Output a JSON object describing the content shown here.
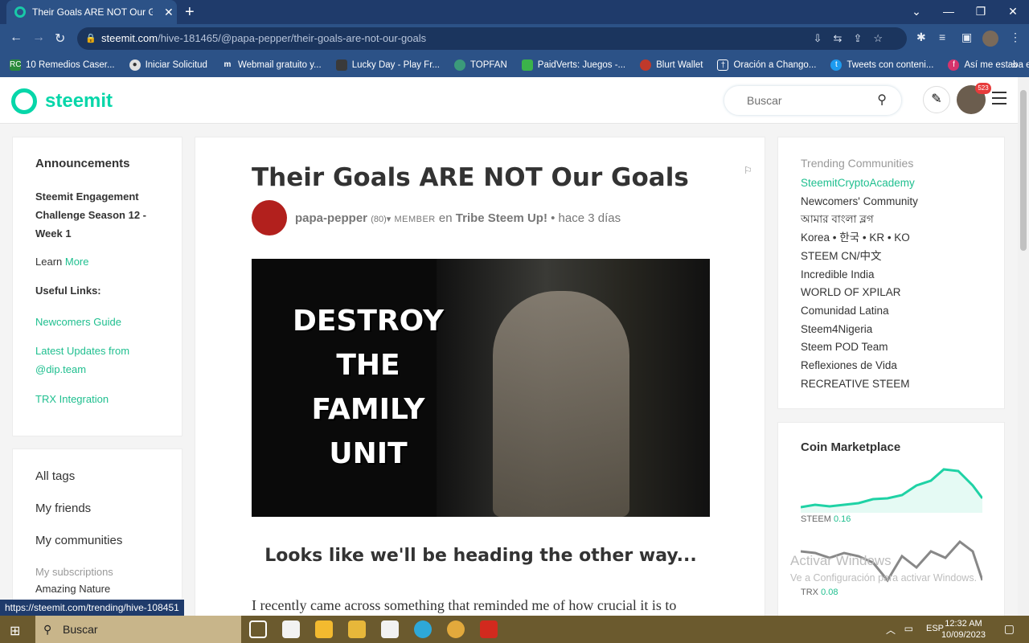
{
  "browser": {
    "tab_title": "Their Goals ARE NOT Our Goals —",
    "url_host": "steemit.com",
    "url_path": "/hive-181465/@papa-pepper/their-goals-are-not-our-goals",
    "bookmarks": [
      {
        "label": "10 Remedios Caser...",
        "icon": "RC",
        "color": "#2a8a3a"
      },
      {
        "label": "Iniciar Solicitud",
        "icon": "●",
        "color": "#e0e0e0"
      },
      {
        "label": "Webmail gratuito y...",
        "icon": "m",
        "color": "#2c5287"
      },
      {
        "label": "Lucky Day - Play Fr...",
        "icon": "■",
        "color": "#3a3a3a"
      },
      {
        "label": "TOPFAN",
        "icon": "◆",
        "color": "#3b9a7a"
      },
      {
        "label": "PaidVerts: Juegos -...",
        "icon": "■",
        "color": "#3bb34a"
      },
      {
        "label": "Blurt Wallet",
        "icon": "●",
        "color": "#c0392b"
      },
      {
        "label": "Oración a Chango...",
        "icon": "†",
        "color": "#ffffff"
      },
      {
        "label": "Tweets con conteni...",
        "icon": "t",
        "color": "#1d9bf0"
      },
      {
        "label": "Así me estaba espe...",
        "icon": "f",
        "color": "#d6336c"
      }
    ],
    "status_url": "https://steemit.com/trending/hive-108451"
  },
  "header": {
    "logo_text": "steemit",
    "search_placeholder": "Buscar",
    "notification_count": "523"
  },
  "left": {
    "announcements_title": "Announcements",
    "announcement_link": "Steemit Engagement Challenge Season 12 - Week 1",
    "learn_prefix": "Learn",
    "learn_link": "More",
    "useful_title": "Useful Links:",
    "links": [
      "Newcomers Guide",
      "Latest Updates from @dip.team",
      "TRX Integration"
    ],
    "nav": [
      "All tags",
      "My friends",
      "My communities"
    ],
    "subscriptions_title": "My subscriptions",
    "subscriptions": [
      "Amazing Nature"
    ]
  },
  "post": {
    "title": "Their Goals ARE NOT Our Goals",
    "author": "papa-pepper",
    "reputation": "(80)",
    "role": "MEMBER",
    "in_word": "en",
    "community": "Tribe Steem Up!",
    "time": "• hace 3 días",
    "image_text": "DESTROY THE FAMILY UNIT",
    "subtitle": "Looks like we'll be heading the other way...",
    "body_start": "I recently came across something that reminded me of how crucial it is to"
  },
  "right": {
    "trending_title": "Trending Communities",
    "communities": [
      "SteemitCryptoAcademy",
      "Newcomers' Community",
      "আমার বাংলা ব্লগ",
      "Korea • 한국 • KR • KO",
      "STEEM CN/中文",
      "Incredible India",
      "WORLD OF XPILAR",
      "Comunidad Latina",
      "Steem4Nigeria",
      "Steem POD Team",
      "Reflexiones de Vida",
      "RECREATIVE STEEM"
    ],
    "coin_title": "Coin Marketplace",
    "coins": [
      {
        "name": "STEEM",
        "price": "0.16"
      },
      {
        "name": "TRX",
        "price": "0.08"
      }
    ]
  },
  "windows": {
    "activate_title": "Activar Windows",
    "activate_sub": "Ve a Configuración para activar Windows.",
    "taskbar_search": "Buscar",
    "lang": "ESP",
    "time": "12:32 AM",
    "date": "10/09/2023"
  }
}
